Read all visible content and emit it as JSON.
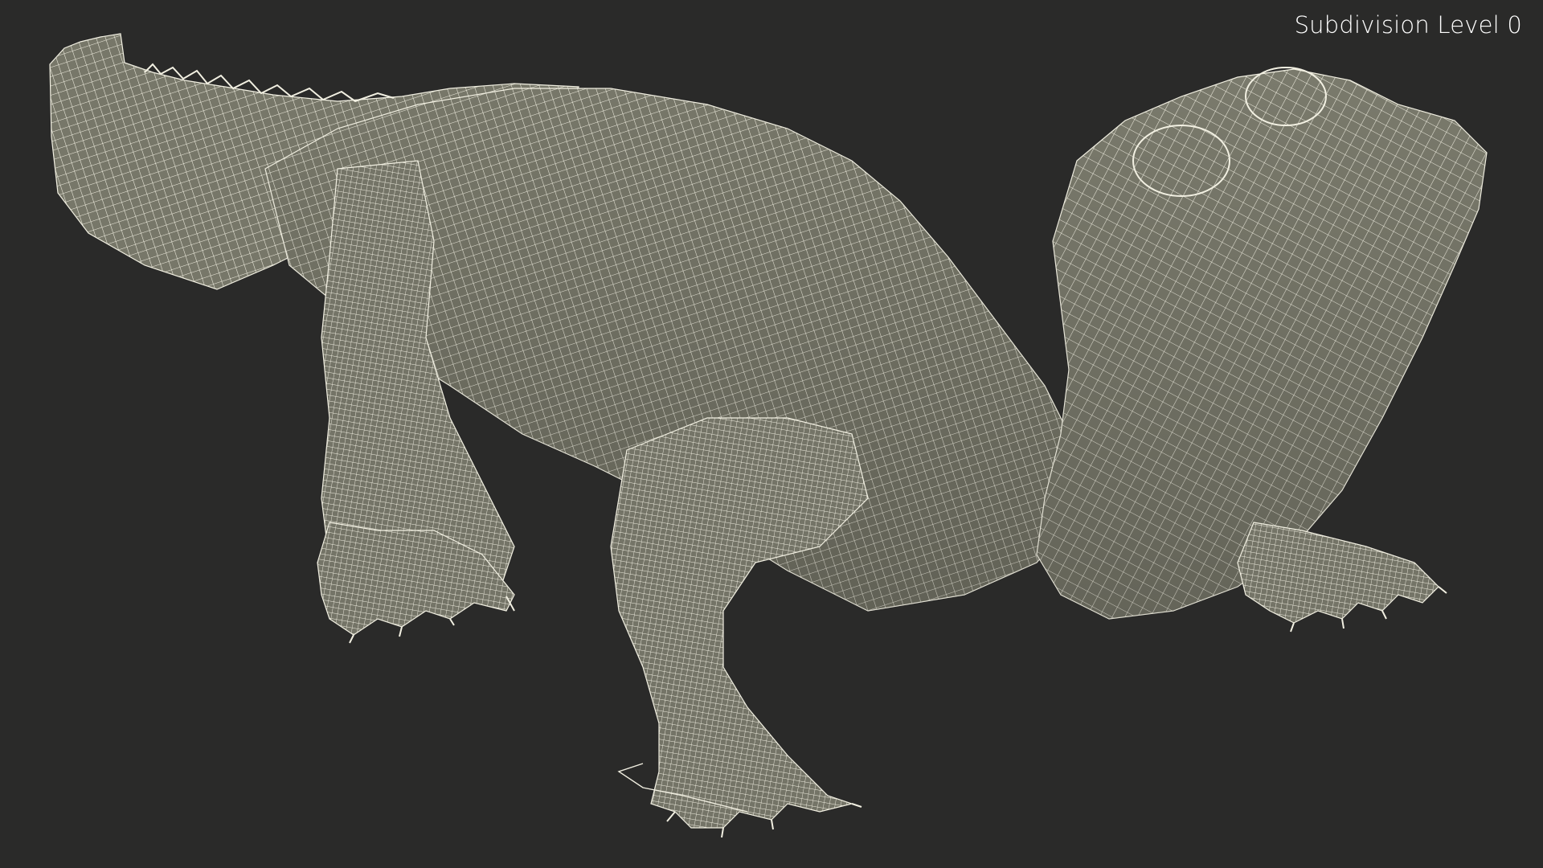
{
  "viewport": {
    "label": "Subdivision Level 0",
    "colors": {
      "background": "#2a2a29",
      "mesh_fill": "#777769",
      "mesh_shadow": "#5e5e53",
      "wire": "#f2f0e2",
      "label": "#ffffff"
    },
    "model_icon": "alligator-wireframe-model"
  }
}
